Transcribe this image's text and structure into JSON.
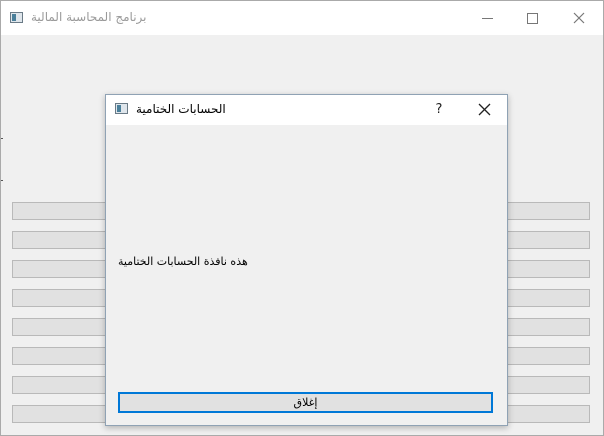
{
  "main_window": {
    "title": "برنامج المحاسبة المالية",
    "content_rows": 8
  },
  "dialog": {
    "title": "الحسابات الختامية",
    "help_label": "?",
    "message": "هذه نافذة الحسابات الختامية",
    "close_button_label": "إغلاق"
  },
  "colors": {
    "accent": "#0078d7",
    "window_bg": "#f0f0f0"
  }
}
